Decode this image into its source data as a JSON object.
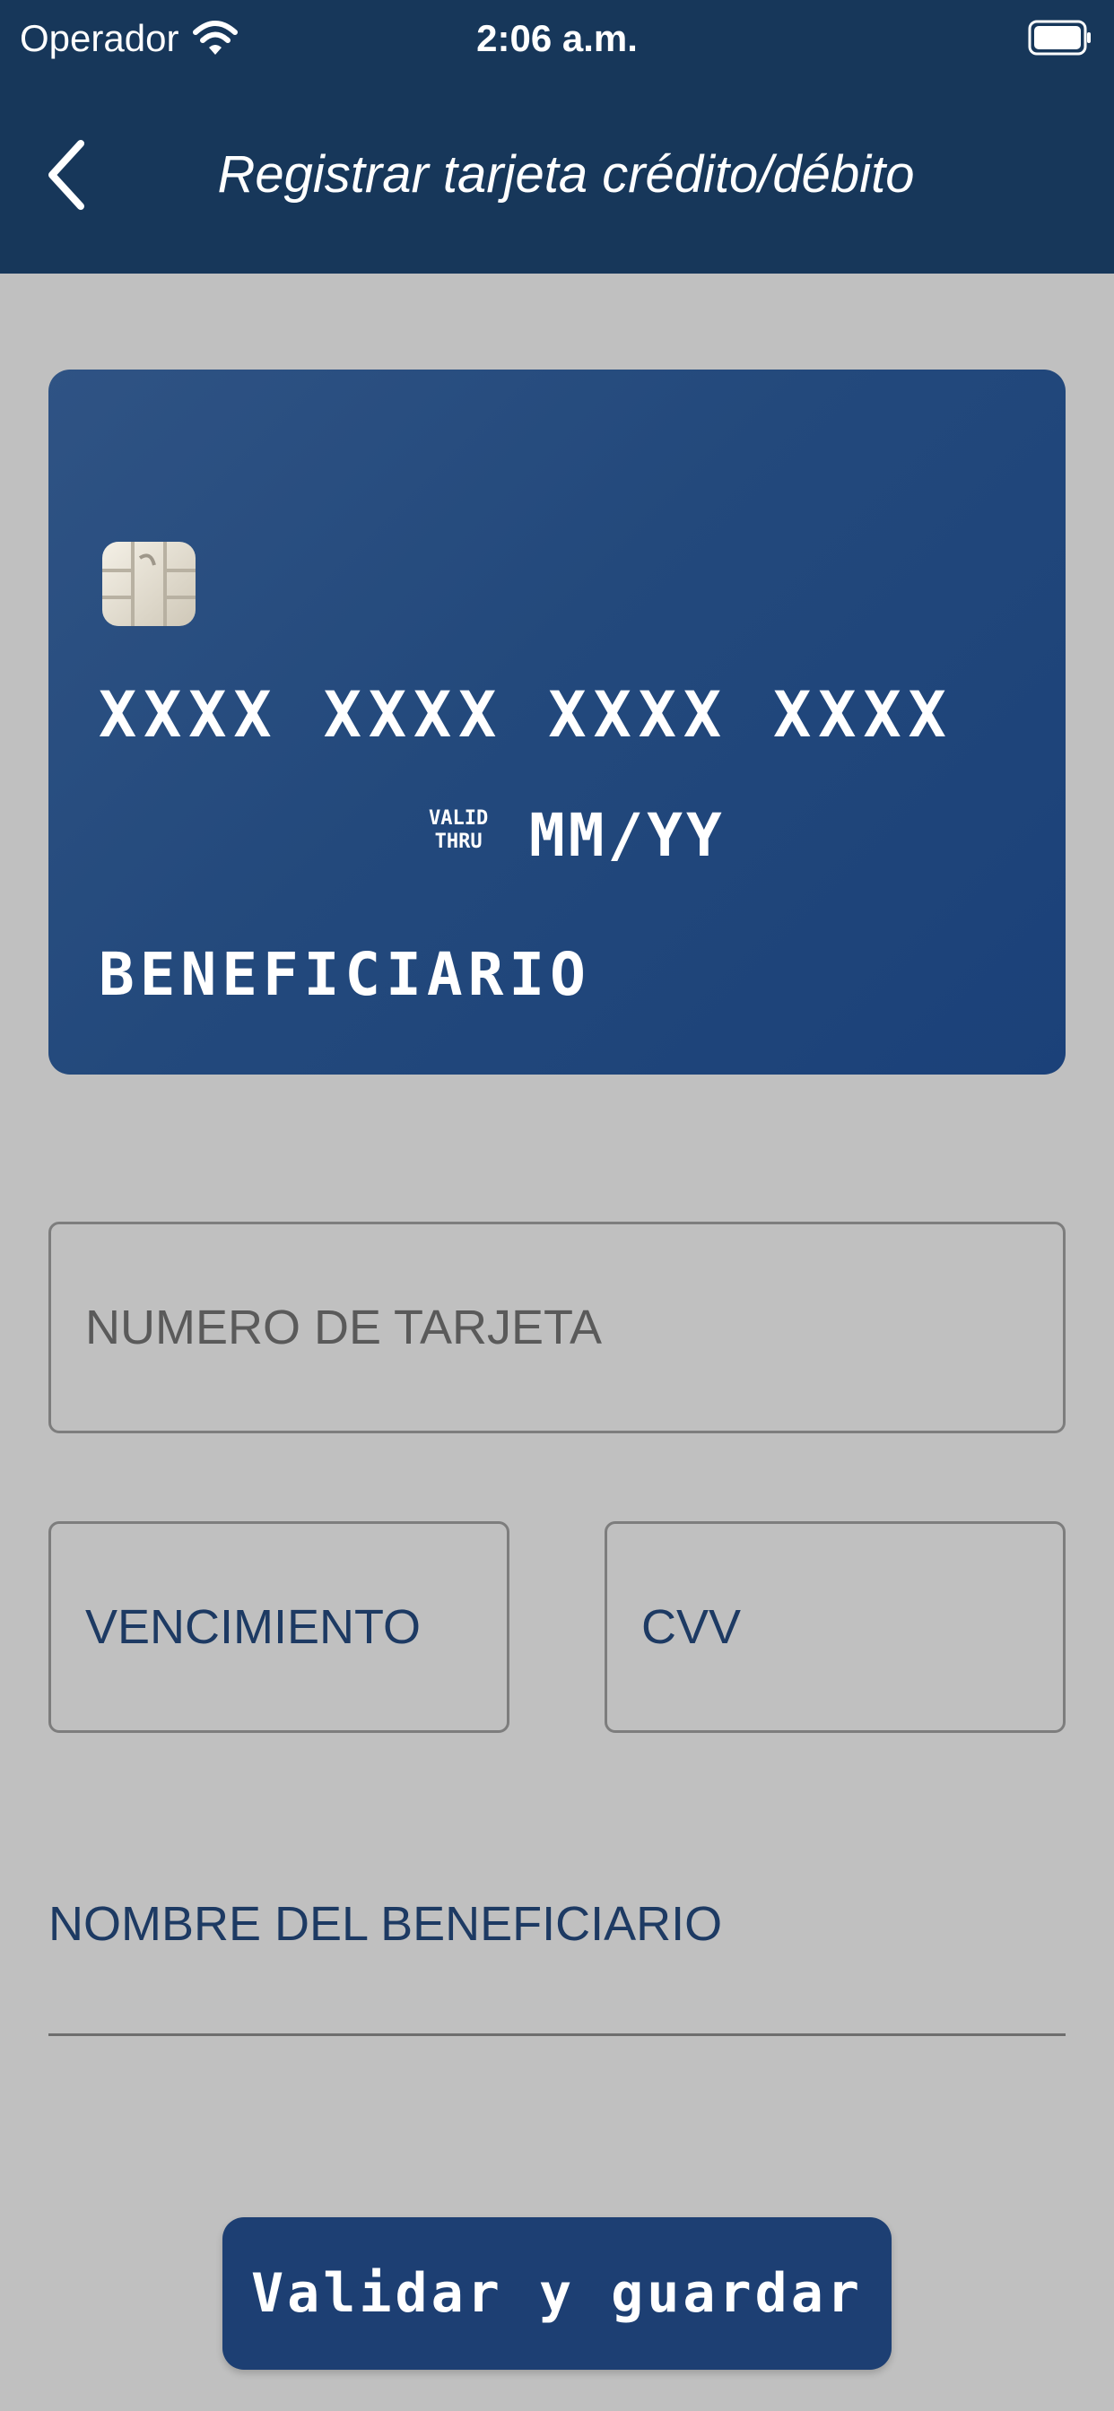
{
  "status_bar": {
    "carrier": "Operador",
    "time": "2:06 a.m.",
    "wifi_icon": "wifi-icon",
    "battery_icon": "battery-full-icon"
  },
  "nav": {
    "back_icon": "chevron-left-icon",
    "title": "Registrar tarjeta crédito/débito"
  },
  "card_preview": {
    "chip_icon": "card-chip-icon",
    "number": "XXXX XXXX XXXX XXXX",
    "valid_line1": "VALID",
    "valid_line2": "THRU",
    "expiry": "MM/YY",
    "holder": "BENEFICIARIO"
  },
  "form": {
    "card_number": {
      "placeholder": "NUMERO DE TARJETA",
      "value": ""
    },
    "expiry": {
      "placeholder": "VENCIMIENTO",
      "value": ""
    },
    "cvv": {
      "placeholder": "CVV",
      "value": ""
    },
    "holder_name": {
      "placeholder": "NOMBRE DEL BENEFICIARIO",
      "value": ""
    }
  },
  "actions": {
    "save_label": "Validar y guardar"
  },
  "colors": {
    "header_bg": "#17375a",
    "page_bg": "#c0c0c0",
    "card_bg": "#23497c",
    "button_bg": "#1d3f73",
    "accent_text": "#1d3a63"
  }
}
